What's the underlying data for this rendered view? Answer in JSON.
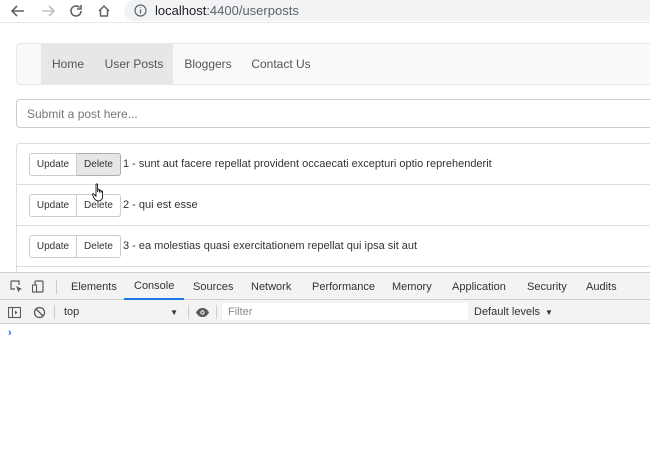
{
  "browser": {
    "back_icon": "arrow-left-icon",
    "forward_icon": "arrow-right-icon",
    "reload_icon": "reload-icon",
    "home_icon": "home-icon",
    "info_icon": "info-icon",
    "url_host": "localhost",
    "url_rest": ":4400/userposts"
  },
  "navbar": {
    "items": [
      {
        "label": "Home"
      },
      {
        "label": "User Posts"
      },
      {
        "label": "Bloggers"
      },
      {
        "label": "Contact Us"
      }
    ]
  },
  "post_input": {
    "placeholder": "Submit a post here..."
  },
  "posts": [
    {
      "update_label": "Update",
      "delete_label": "Delete",
      "text": "1 - sunt aut facere repellat provident occaecati excepturi optio reprehenderit"
    },
    {
      "update_label": "Update",
      "delete_label": "Delete",
      "text": "2 - qui est esse"
    },
    {
      "update_label": "Update",
      "delete_label": "Delete",
      "text": "3 - ea molestias quasi exercitationem repellat qui ipsa sit aut"
    }
  ],
  "devtools": {
    "tabs": [
      {
        "label": "Elements"
      },
      {
        "label": "Console"
      },
      {
        "label": "Sources"
      },
      {
        "label": "Network"
      },
      {
        "label": "Performance"
      },
      {
        "label": "Memory"
      },
      {
        "label": "Application"
      },
      {
        "label": "Security"
      },
      {
        "label": "Audits"
      }
    ],
    "active_tab": "Console",
    "context": "top",
    "filter_placeholder": "Filter",
    "levels_label": "Default levels",
    "prompt": "›",
    "accent_color": "#1a73e8"
  }
}
